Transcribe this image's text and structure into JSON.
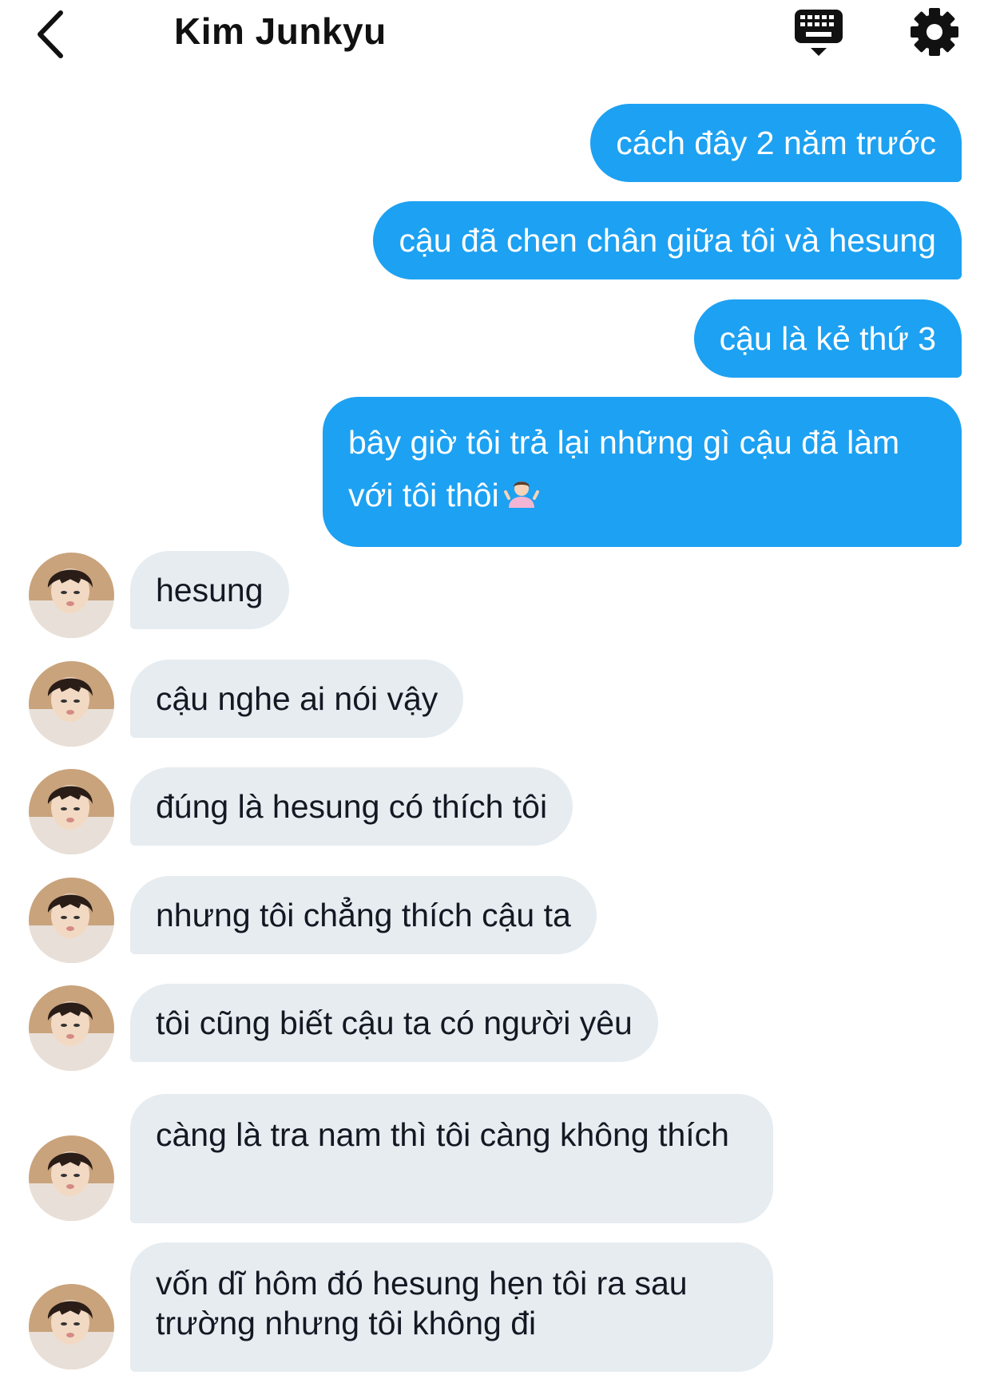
{
  "header": {
    "title": "Kim Junkyu",
    "back_icon": "chevron-left-icon",
    "keyboard_icon": "keyboard-icon",
    "settings_icon": "gear-icon"
  },
  "colors": {
    "sent_bubble": "#1da1f2",
    "received_bubble": "#e6ecf0",
    "background": "#ffffff"
  },
  "messages_sent": [
    {
      "text": "cách đây 2 năm trước"
    },
    {
      "text": "cậu đã chen chân giữa tôi và hesung"
    },
    {
      "text": "cậu là kẻ thứ 3"
    },
    {
      "text": "bây giờ tôi trả lại những gì cậu đã làm với tôi thôi",
      "emoji": "person-shrugging-emoji"
    }
  ],
  "messages_received": [
    {
      "text": "hesung"
    },
    {
      "text": "cậu nghe ai nói vậy"
    },
    {
      "text": "đúng là hesung có thích tôi"
    },
    {
      "text": "nhưng tôi chẳng thích cậu ta"
    },
    {
      "text": "tôi cũng biết cậu ta có người yêu"
    },
    {
      "text": "càng là tra nam thì tôi càng không thích"
    },
    {
      "text": "vốn dĩ hôm đó hesung hẹn tôi ra sau trường nhưng tôi không đi"
    }
  ]
}
